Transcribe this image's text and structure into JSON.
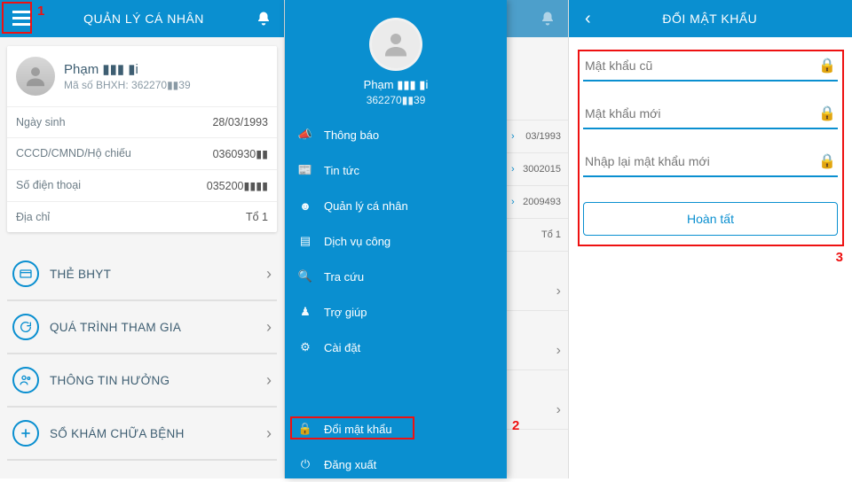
{
  "screen1": {
    "header_title": "QUẢN LÝ CÁ NHÂN",
    "user_name": "Phạm ▮▮▮ ▮i",
    "user_code_label": "Mã số BHXH:",
    "user_code": "362270▮▮39",
    "rows": [
      {
        "k": "Ngày sinh",
        "v": "28/03/1993"
      },
      {
        "k": "CCCD/CMND/Hộ chiếu",
        "v": "0360930▮▮"
      },
      {
        "k": "Số điện thoại",
        "v": "035200▮▮▮▮"
      },
      {
        "k": "Địa chỉ",
        "v": "Tổ 1"
      }
    ],
    "menu": [
      {
        "label": "THẺ BHYT",
        "icon": "card-icon"
      },
      {
        "label": "QUÁ TRÌNH THAM GIA",
        "icon": "refresh-icon"
      },
      {
        "label": "THÔNG TIN HƯỞNG",
        "icon": "people-icon"
      },
      {
        "label": "SỔ KHÁM CHỮA BỆNH",
        "icon": "plus-icon"
      }
    ],
    "callout": "1"
  },
  "screen2": {
    "drawer_name": "Phạm ▮▮▮ ▮i",
    "drawer_code": "362270▮▮39",
    "items": [
      {
        "label": "Thông báo",
        "icon": "megaphone-icon"
      },
      {
        "label": "Tin tức",
        "icon": "news-icon"
      },
      {
        "label": "Quản lý cá nhân",
        "icon": "person-icon"
      },
      {
        "label": "Dịch vụ công",
        "icon": "service-icon"
      },
      {
        "label": "Tra cứu",
        "icon": "search-icon"
      },
      {
        "label": "Trợ giúp",
        "icon": "help-icon"
      },
      {
        "label": "Cài đặt",
        "icon": "gear-icon"
      },
      {
        "label": "Đổi mật khẩu",
        "icon": "lock-icon"
      },
      {
        "label": "Đăng xuất",
        "icon": "power-icon"
      }
    ],
    "peek": [
      "03/1993",
      "3002015",
      "2009493",
      "Tổ 1"
    ],
    "callout": "2"
  },
  "screen3": {
    "header_title": "ĐỔI MẬT KHẨU",
    "old_pw": "Mật khẩu cũ",
    "new_pw": "Mật khẩu mới",
    "re_pw": "Nhập lại mật khẩu mới",
    "submit": "Hoàn tất",
    "callout": "3"
  }
}
